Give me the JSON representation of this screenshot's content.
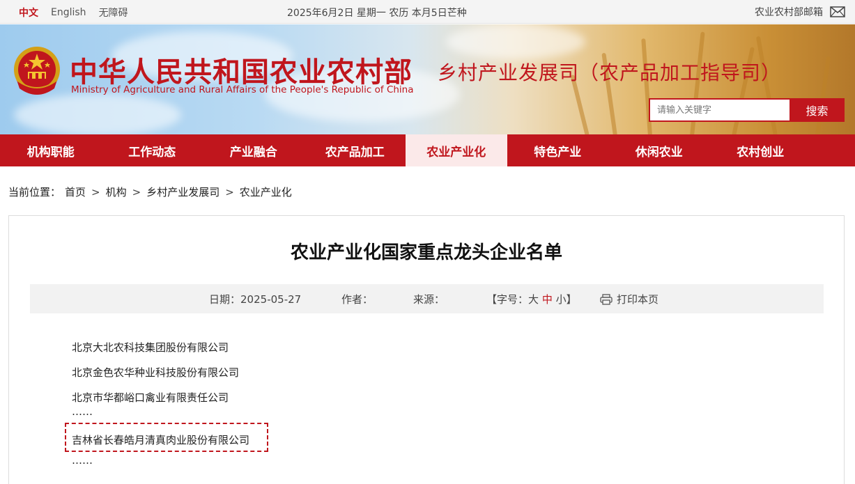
{
  "topbar": {
    "lang_zh": "中文",
    "lang_en": "English",
    "accessibility": "无障碍",
    "date": "2025年6月2日 星期一 农历 本月5日芒种",
    "mail_label": "农业农村部邮箱",
    "mail_icon": "envelope-icon"
  },
  "header": {
    "site_title": "中华人民共和国农业农村部",
    "site_subtitle": "Ministry of Agriculture and Rural Affairs of the People's Republic of China",
    "dept_title": "乡村产业发展司（农产品加工指导司）",
    "emblem": "national-emblem"
  },
  "search": {
    "placeholder": "请输入关键字",
    "button_label": "搜索"
  },
  "nav": {
    "items": [
      {
        "label": "机构职能"
      },
      {
        "label": "工作动态"
      },
      {
        "label": "产业融合"
      },
      {
        "label": "农产品加工"
      },
      {
        "label": "农业产业化"
      },
      {
        "label": "特色产业"
      },
      {
        "label": "休闲农业"
      },
      {
        "label": "农村创业"
      }
    ],
    "active_index": 4
  },
  "breadcrumb": {
    "prefix": "当前位置：",
    "items": [
      "首页",
      "机构",
      "乡村产业发展司",
      "农业产业化"
    ],
    "separator": ">"
  },
  "article": {
    "title": "农业产业化国家重点龙头企业名单",
    "date_label": "日期：",
    "date": "2025-05-27",
    "author_label": "作者：",
    "source_label": "来源：",
    "font_size_label": "【字号：",
    "font_large": "大",
    "font_medium": "中",
    "font_small": "小】",
    "print_label": "打印本页",
    "lines": [
      "北京大北农科技集团股份有限公司",
      "北京金色农华种业科技股份有限公司",
      "北京市华都峪口禽业有限责任公司",
      "……",
      "吉林省长春皓月清真肉业股份有限公司",
      "……"
    ]
  },
  "colors": {
    "brand_red": "#c0161d",
    "nav_active_bg": "#fbe9e9",
    "meta_bg": "#f2f2f2"
  }
}
